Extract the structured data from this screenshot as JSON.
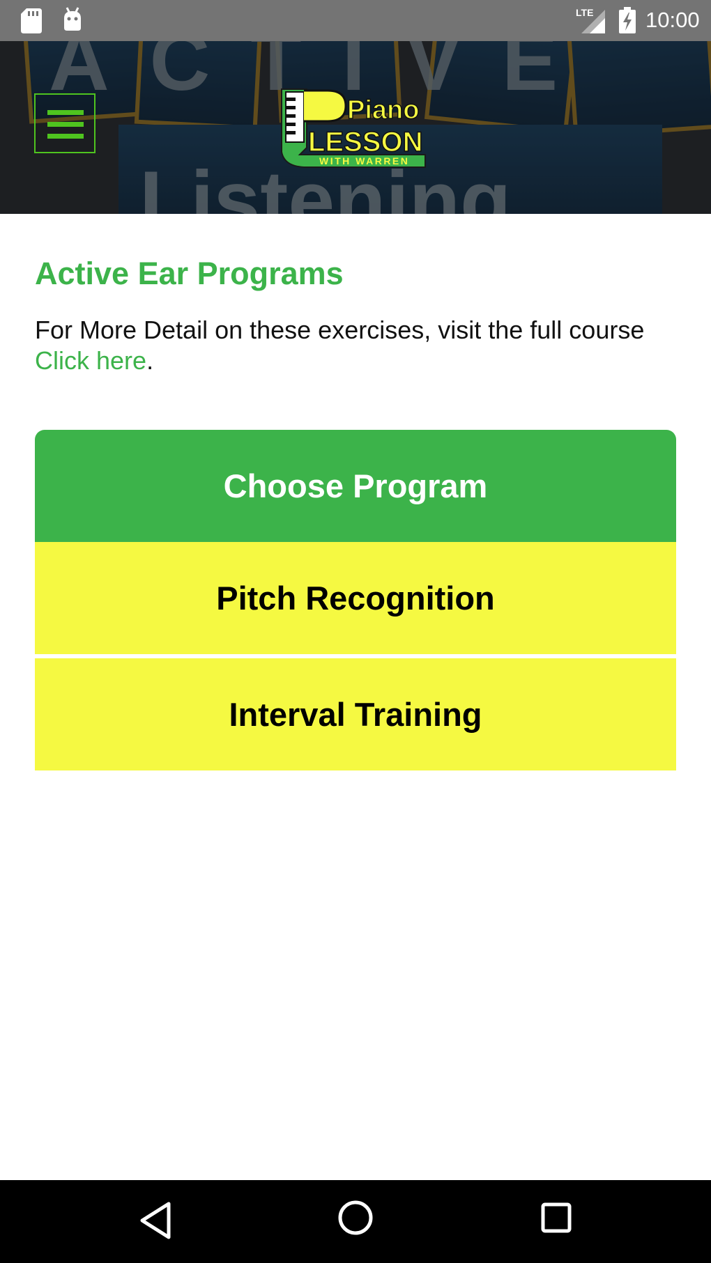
{
  "status_bar": {
    "time": "10:00",
    "network": "LTE",
    "icons": [
      "sd-card-icon",
      "android-debug-icon",
      "lte-signal-icon",
      "battery-charging-icon"
    ]
  },
  "header": {
    "background_text_top": "ACTIVE",
    "background_text_bottom": "Listening",
    "logo": {
      "line1": "Piano",
      "line2": "LESSON",
      "line3": "WITH WARREN"
    },
    "menu_icon": "hamburger-icon"
  },
  "main": {
    "title": "Active Ear Programs",
    "description": "For More Detail on these exercises, visit the full course",
    "link_text": "Click here",
    "link_suffix": "."
  },
  "program_menu": {
    "header": "Choose Program",
    "options": [
      {
        "label": "Pitch Recognition"
      },
      {
        "label": "Interval Training"
      }
    ]
  },
  "nav_bar": {
    "icons": [
      "back-icon",
      "home-icon",
      "recents-icon"
    ]
  },
  "colors": {
    "accent_green": "#3cb34a",
    "option_yellow": "#f5f942",
    "status_bar": "#747474",
    "nav_bar": "#000000"
  }
}
